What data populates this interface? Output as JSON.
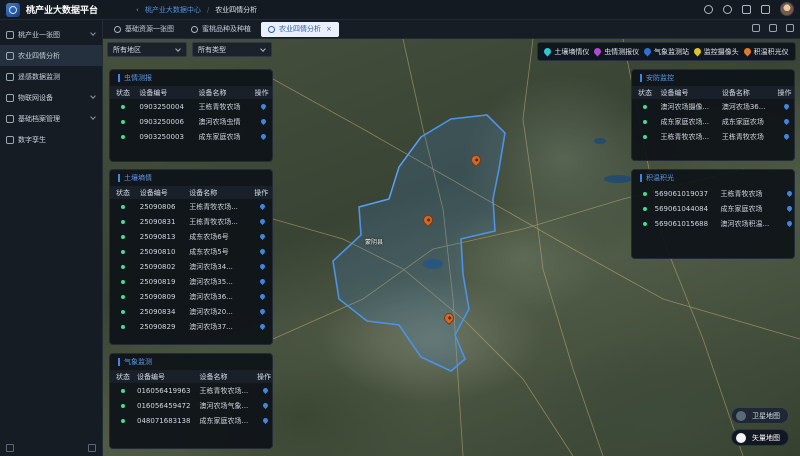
{
  "app": {
    "title": "桃产业大数据平台"
  },
  "breadcrumb": {
    "home": "桃产业大数据中心",
    "current": "农业四情分析"
  },
  "sidebar": {
    "items": [
      {
        "label": "桃产业一张图",
        "expandable": true
      },
      {
        "label": "农业四情分析",
        "expandable": false,
        "active": true
      },
      {
        "label": "遥感数据监测",
        "expandable": false
      },
      {
        "label": "物联网设备",
        "expandable": true
      },
      {
        "label": "基础档案管理",
        "expandable": true
      },
      {
        "label": "数字孪生",
        "expandable": false
      }
    ]
  },
  "tabs": [
    {
      "label": "基础资源一张图",
      "icon": "layers-icon"
    },
    {
      "label": "蜜桃品种及种植",
      "icon": "refresh-icon"
    },
    {
      "label": "农业四情分析",
      "icon": "chart-icon",
      "active": true,
      "close": "×"
    }
  ],
  "filters": {
    "region": "所有地区",
    "type": "所有类型"
  },
  "legend": [
    {
      "label": "土壤墒情仪",
      "color": "#2ec7d6"
    },
    {
      "label": "虫情测报仪",
      "color": "#b04ad6"
    },
    {
      "label": "气象监测站",
      "color": "#2f6fd6"
    },
    {
      "label": "监控摄像头",
      "color": "#e0c22a"
    },
    {
      "label": "积温积光仪",
      "color": "#e07a2a"
    }
  ],
  "panels": {
    "insect": {
      "title": "虫情测报",
      "headers": [
        "状态",
        "设备编号",
        "设备名称",
        "操作"
      ],
      "rows": [
        {
          "id": "0903250004",
          "name": "王栋青牧农场"
        },
        {
          "id": "0903250006",
          "name": "澳河农场虫情"
        },
        {
          "id": "0903250003",
          "name": "成东家庭农场"
        }
      ]
    },
    "soil": {
      "title": "土壤墒情",
      "headers": [
        "状态",
        "设备编号",
        "设备名称",
        "操作"
      ],
      "rows": [
        {
          "id": "25090806",
          "name": "王栋青牧农场..."
        },
        {
          "id": "25090831",
          "name": "王栋青牧农场..."
        },
        {
          "id": "25090813",
          "name": "成东农场6号"
        },
        {
          "id": "25090810",
          "name": "成东农场5号"
        },
        {
          "id": "25090802",
          "name": "澳河农场34..."
        },
        {
          "id": "25090819",
          "name": "澳河农场35..."
        },
        {
          "id": "25090809",
          "name": "澳河农场36..."
        },
        {
          "id": "25090834",
          "name": "澳河农场20..."
        },
        {
          "id": "25090829",
          "name": "澳河农场37..."
        }
      ]
    },
    "weather": {
      "title": "气象监测",
      "headers": [
        "状态",
        "设备编号",
        "设备名称",
        "操作"
      ],
      "rows": [
        {
          "id": "016056419963",
          "name": "王栋青牧农场..."
        },
        {
          "id": "016056459472",
          "name": "澳河农场气象..."
        },
        {
          "id": "048071683138",
          "name": "成东家庭农场..."
        }
      ]
    },
    "camera": {
      "title": "安防监控",
      "headers": [
        "状态",
        "设备编号",
        "设备名称",
        "操作"
      ],
      "rows": [
        {
          "id": "澳河农场摄像...",
          "name": "澳河农场36..."
        },
        {
          "id": "成东家庭农场...",
          "name": "成东家庭农场"
        },
        {
          "id": "王栋青牧农场...",
          "name": "王栋青牧农场"
        }
      ]
    },
    "accum": {
      "title": "积温积光",
      "headers": [
        "状态",
        "设备编号",
        "设备名称",
        "操作"
      ],
      "rows": [
        {
          "id": "569061019037",
          "name": "王栋青牧农场"
        },
        {
          "id": "569061044084",
          "name": "成东家庭农场"
        },
        {
          "id": "569061015688",
          "name": "澳河农场积温..."
        }
      ]
    }
  },
  "map": {
    "center_label": "蒙阴县"
  },
  "layers": {
    "satellite": "卫星地图",
    "vector": "矢量地图"
  }
}
